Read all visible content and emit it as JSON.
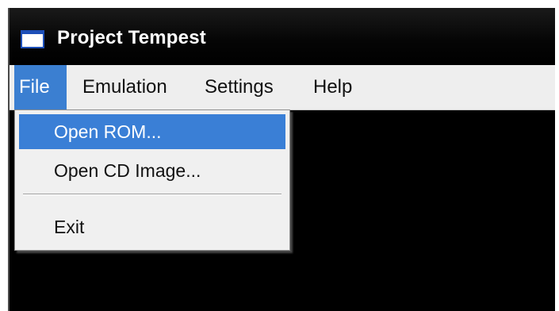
{
  "window": {
    "title": "Project Tempest",
    "icon": "app-window-icon"
  },
  "menubar": {
    "items": [
      {
        "label": "File",
        "active": true
      },
      {
        "label": "Emulation"
      },
      {
        "label": "Settings"
      },
      {
        "label": "Help"
      }
    ]
  },
  "file_menu": {
    "items": [
      {
        "label": "Open ROM...",
        "highlighted": true
      },
      {
        "label": "Open CD Image..."
      },
      {
        "separator": true
      },
      {
        "label": "Exit"
      }
    ]
  },
  "colors": {
    "highlight": "#3a7fd6",
    "menubar_bg": "#eeeeee",
    "dropdown_bg": "#f0f0f0",
    "client_bg": "#000000"
  }
}
